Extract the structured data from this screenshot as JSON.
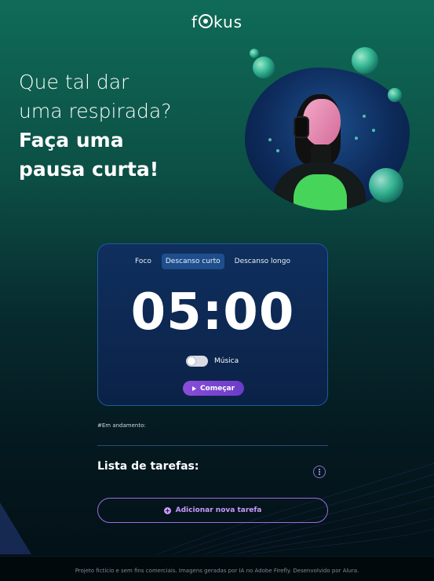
{
  "header": {
    "logo_prefix": "f",
    "logo_suffix": "kus"
  },
  "headline": {
    "light_line1": "Que tal dar",
    "light_line2": "uma respirada?",
    "bold_line1": "Faça uma",
    "bold_line2": "pausa curta!"
  },
  "timer_card": {
    "tabs": [
      {
        "label": "Foco",
        "active": false
      },
      {
        "label": "Descanso curto",
        "active": true
      },
      {
        "label": "Descanso longo",
        "active": false
      }
    ],
    "time": "05:00",
    "music_label": "Música",
    "music_on": false,
    "start_label": "Começar",
    "play_icon": "play-icon"
  },
  "tasks": {
    "in_progress_label": "#Em andamento:",
    "title": "Lista de tarefas:",
    "menu_icon": "kebab-menu-icon",
    "add_label": "Adicionar nova tarefa",
    "add_icon": "plus-circle-icon"
  },
  "footer": {
    "text": "Projeto fictício e sem fins comerciais. Imagens geradas por IA no Adobe Firefly. Desenvolvido por Alura."
  },
  "colors": {
    "accent_purple": "#8a4ed8",
    "card_bg": "#0f2f5e",
    "active_tab": "#1e4e8c"
  }
}
